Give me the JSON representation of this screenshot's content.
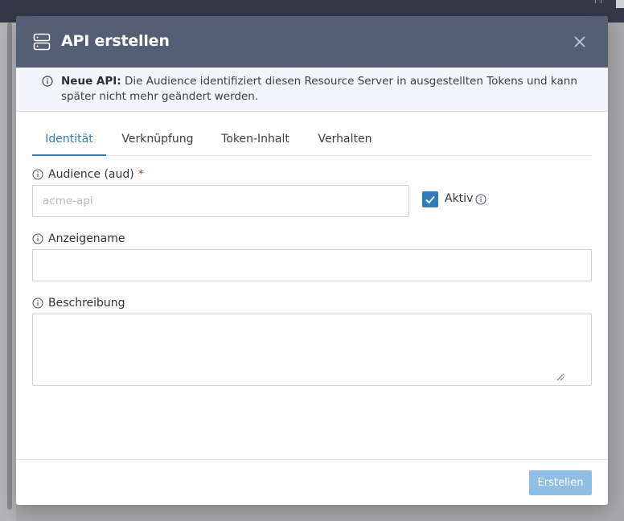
{
  "colors": {
    "header_bg": "#545e75",
    "accent": "#2f7bbd",
    "submit_disabled": "#8fbde4",
    "required": "#c0392b"
  },
  "modal": {
    "title": "API erstellen",
    "header_icon": "server-icon",
    "close_icon": "close-icon"
  },
  "banner": {
    "icon": "info-icon",
    "bold": "Neue API:",
    "text": " Die Audience identifiziert diesen Resource Server in ausgestellten Tokens und kann später nicht mehr geändert werden."
  },
  "tabs": [
    {
      "label": "Identität",
      "active": true
    },
    {
      "label": "Verknüpfung",
      "active": false
    },
    {
      "label": "Token-Inhalt",
      "active": false
    },
    {
      "label": "Verhalten",
      "active": false
    }
  ],
  "form": {
    "audience": {
      "label": "Audience (aud)",
      "required_mark": "*",
      "value": "",
      "placeholder": "acme-api"
    },
    "active": {
      "label": "Aktiv",
      "checked": true
    },
    "display_name": {
      "label": "Anzeigename",
      "value": "",
      "placeholder": ""
    },
    "description": {
      "label": "Beschreibung",
      "value": "",
      "placeholder": ""
    }
  },
  "footer": {
    "submit_label": "Erstellen",
    "submit_enabled": false
  }
}
